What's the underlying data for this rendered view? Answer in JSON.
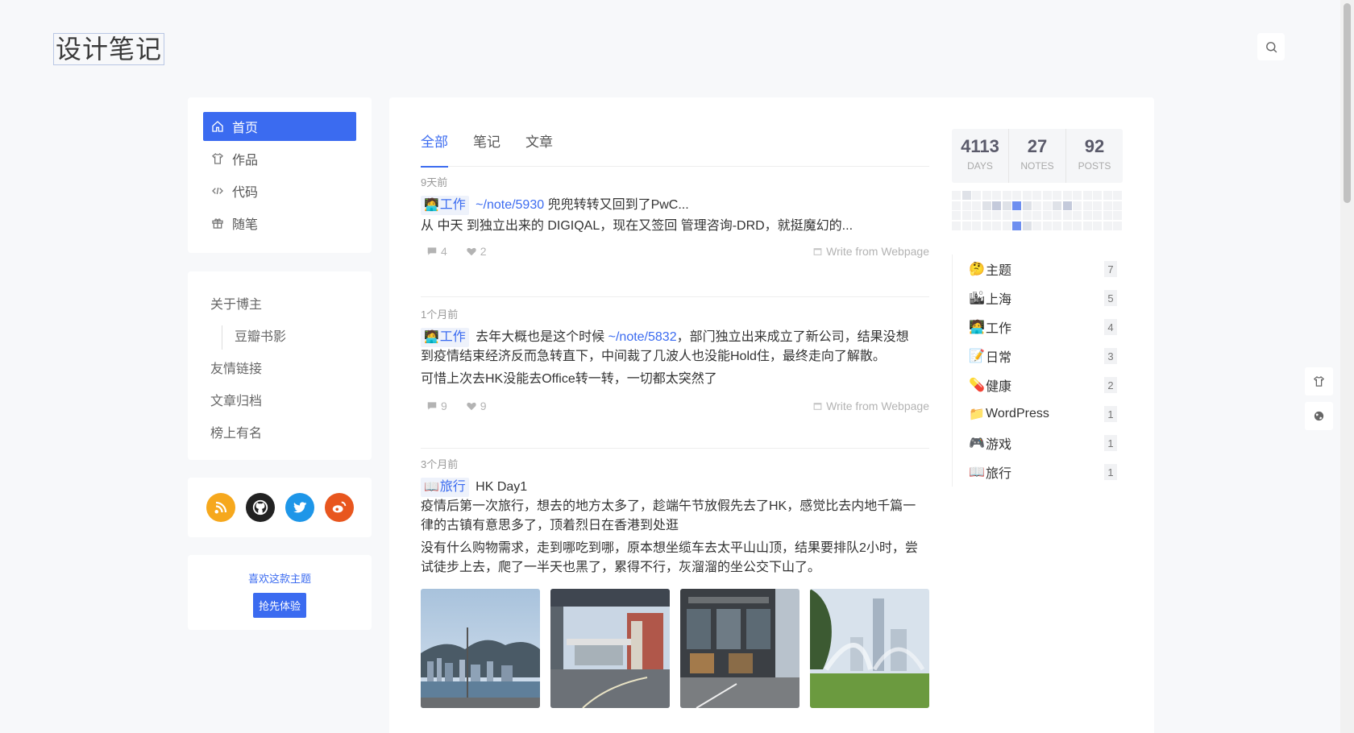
{
  "site": {
    "logo": "设计笔记"
  },
  "nav": {
    "items": [
      {
        "label": "首页",
        "icon": "home-icon",
        "active": true
      },
      {
        "label": "作品",
        "icon": "shirt-icon"
      },
      {
        "label": "代码",
        "icon": "code-icon"
      },
      {
        "label": "随笔",
        "icon": "gift-icon"
      }
    ]
  },
  "links": {
    "about": "关于博主",
    "douban": "豆瓣书影",
    "friends": "友情链接",
    "archive": "文章归档",
    "ranking": "榜上有名"
  },
  "social": [
    "rss-icon",
    "github-icon",
    "twitter-icon",
    "weibo-icon"
  ],
  "promo": {
    "text": "喜欢这款主题",
    "button": "抢先体验"
  },
  "tabs": [
    "全部",
    "笔记",
    "文章"
  ],
  "posts": [
    {
      "time": "9天前",
      "tag": "工作",
      "tag_emoji": "🧑‍💻",
      "link": "~/note/5930",
      "title": "兜兜转转又回到了PwC...",
      "line2": "从 中天 到独立出来的 DIGIQAL，现在又签回 管理咨询-DRD，就挺魔幻的...",
      "comments": "4",
      "likes": "2",
      "source": "Write from Webpage"
    },
    {
      "time": "1个月前",
      "tag": "工作",
      "tag_emoji": "🧑‍💻",
      "pre_link": "去年大概也是这个时候",
      "link": "~/note/5832",
      "post_link": "，部门独立出来成立了新公司，结果没想",
      "line2": "到疫情结束经济反而急转直下，中间裁了几波人也没能Hold住，最终走向了解散。",
      "line3": "可惜上次去HK没能去Office转一转，一切都太突然了",
      "comments": "9",
      "likes": "9",
      "source": "Write from Webpage"
    },
    {
      "time": "3个月前",
      "tag": "旅行",
      "tag_emoji": "📖",
      "title": "HK Day1",
      "line2": "疫情后第一次旅行，想去的地方太多了，趁端午节放假先去了HK，感觉比去内地千篇一",
      "line3": "律的古镇有意思多了，顶着烈日在香港到处逛",
      "line4": "没有什么购物需求，走到哪吃到哪，原本想坐缆车去太平山山顶，结果要排队2小时，尝",
      "line5": "试徒步上去，爬了一半天也黑了，累得不行，灰溜溜的坐公交下山了。"
    }
  ],
  "stats": [
    {
      "num": "4113",
      "label": "DAYS"
    },
    {
      "num": "27",
      "label": "NOTES"
    },
    {
      "num": "92",
      "label": "POSTS"
    }
  ],
  "heatmap": [
    0,
    1,
    0,
    0,
    0,
    0,
    0,
    0,
    0,
    0,
    0,
    0,
    0,
    0,
    0,
    0,
    0,
    0,
    0,
    0,
    1,
    2,
    1,
    3,
    1,
    0,
    0,
    1,
    2,
    0,
    0,
    0,
    0,
    0,
    0,
    0,
    0,
    0,
    0,
    0,
    0,
    0,
    0,
    0,
    0,
    0,
    0,
    0,
    0,
    0,
    0,
    0,
    0,
    0,
    0,
    0,
    0,
    3,
    1,
    0,
    0,
    0,
    0,
    0,
    0,
    0,
    0,
    0
  ],
  "topics": [
    {
      "emoji": "🤔",
      "label": "主题",
      "count": "7"
    },
    {
      "emoji": "🏙",
      "label": "上海",
      "count": "5"
    },
    {
      "emoji": "🧑‍💻",
      "label": "工作",
      "count": "4"
    },
    {
      "emoji": "📝",
      "label": "日常",
      "count": "3"
    },
    {
      "emoji": "💊",
      "label": "健康",
      "count": "2"
    },
    {
      "emoji": "📁",
      "label": "WordPress",
      "count": "1"
    },
    {
      "emoji": "🎮",
      "label": "游戏",
      "count": "1"
    },
    {
      "emoji": "📖",
      "label": "旅行",
      "count": "1"
    }
  ]
}
